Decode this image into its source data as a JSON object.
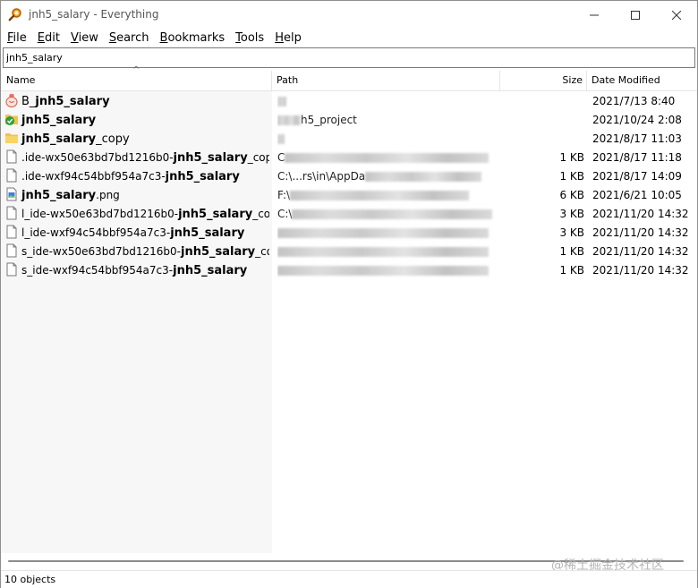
{
  "window": {
    "title": "jnh5_salary - Everything",
    "app_icon": "magnifier-icon"
  },
  "menu": [
    {
      "key": "F",
      "rest": "ile"
    },
    {
      "key": "E",
      "rest": "dit"
    },
    {
      "key": "V",
      "rest": "iew"
    },
    {
      "key": "S",
      "rest": "earch"
    },
    {
      "key": "B",
      "rest": "ookmarks"
    },
    {
      "key": "T",
      "rest": "ools"
    },
    {
      "key": "H",
      "rest": "elp"
    }
  ],
  "search": {
    "value": "jnh5_salary"
  },
  "columns": {
    "name": "Name",
    "path": "Path",
    "size": "Size",
    "date": "Date Modified"
  },
  "rows": [
    {
      "icon": "bag-icon",
      "pre": "B_",
      "match": "jnh5_salary",
      "post": "",
      "path": "",
      "size": "",
      "date": "2021/7/13 8:40"
    },
    {
      "icon": "folder-check-icon",
      "pre": "",
      "match": "jnh5_salary",
      "post": "",
      "path": "h5_project",
      "size": "",
      "date": "2021/10/24 2:08"
    },
    {
      "icon": "folder-icon",
      "pre": "",
      "match": "jnh5_salary",
      "post": "_copy",
      "path": "",
      "size": "",
      "date": "2021/8/17 11:03"
    },
    {
      "icon": "file-icon",
      "pre": ".ide-wx50e63bd7bd1216b0-",
      "match": "jnh5_salary",
      "post": "_copy",
      "path": "C",
      "size": "1 KB",
      "date": "2021/8/17 11:18"
    },
    {
      "icon": "file-icon",
      "pre": ".ide-wxf94c54bbf954a7c3-",
      "match": "jnh5_salary",
      "post": "",
      "path": "C:\\...rs\\in\\AppDa",
      "size": "1 KB",
      "date": "2021/8/17 14:09"
    },
    {
      "icon": "image-file-icon",
      "pre": "",
      "match": "jnh5_salary",
      "post": ".png",
      "path": "F:\\",
      "size": "6 KB",
      "date": "2021/6/21 10:05"
    },
    {
      "icon": "file-icon",
      "pre": "l_ide-wx50e63bd7bd1216b0-",
      "match": "jnh5_salary",
      "post": "_copy",
      "path": "C:\\",
      "size": "3 KB",
      "date": "2021/11/20 14:32"
    },
    {
      "icon": "file-icon",
      "pre": "l_ide-wxf94c54bbf954a7c3-",
      "match": "jnh5_salary",
      "post": "",
      "path": "",
      "size": "3 KB",
      "date": "2021/11/20 14:32"
    },
    {
      "icon": "file-icon",
      "pre": "s_ide-wx50e63bd7bd1216b0-",
      "match": "jnh5_salary",
      "post": "_co...",
      "path": "",
      "size": "1 KB",
      "date": "2021/11/20 14:32"
    },
    {
      "icon": "file-icon",
      "pre": "s_ide-wxf94c54bbf954a7c3-",
      "match": "jnh5_salary",
      "post": "",
      "path": "",
      "size": "1 KB",
      "date": "2021/11/20 14:32"
    }
  ],
  "status": {
    "text": "10 objects"
  },
  "watermark": "@稀土掘金技术社区",
  "colors": {
    "check_green": "#2e9d3a",
    "folder_yellow": "#f2c14e",
    "title_gray": "#555555"
  }
}
